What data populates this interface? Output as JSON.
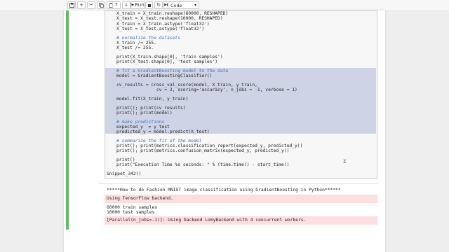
{
  "toolbar": {
    "run_label": "Run",
    "cell_type": "Code"
  },
  "code_lines": [
    "X_train = X_train.reshape(60000, RESHAPED)",
    "X_test = X_test.reshape(10000, RESHAPED)",
    "X_train = X_train.astype('float32')",
    "X_test = X_test.astype('float32')",
    "# normalize the datasets",
    "X_train /= 255.",
    "X_test /= 255.",
    "print(X_train.shape[0], 'train samples')",
    "print(X_test.shape[0], 'test samples')",
    "# fit a GradientBoosting model to the data",
    "model = GradientBoostingClassifier()",
    "cv_results = cross_val_score(model, X_train, y_train,",
    "               cv = 2, scoring='accuracy', n_jobs = -1, verbose = 1)",
    "model.fit(X_train, y_train)",
    "print(); print(cv_results)",
    "print(); print(model)",
    "# make predictions",
    "expected_y  = y_test",
    "predicted_y = model.predict(X_test)",
    "# summarize the fit of the model",
    "print(); print(metrics.classification_report(expected_y, predicted_y))",
    "print(); print(metrics.confusion_matrix(expected_y, predicted_y))",
    "print()",
    "print(\"Execution Time %s seconds: \" % (time.time() - start_time))"
  ],
  "call_line": "Snippet_342()",
  "output": {
    "header": "*****How to do Fashion MNIST image classification using GradientBoosting in Python******",
    "stderr_1": "Using TensorFlow backend.",
    "train_samples": "60000 train samples",
    "test_samples": "10000 test samples",
    "stderr_2": "[Parallel(n_jobs=-1)]: Using backend LokyBackend with 4 concurrent workers."
  }
}
